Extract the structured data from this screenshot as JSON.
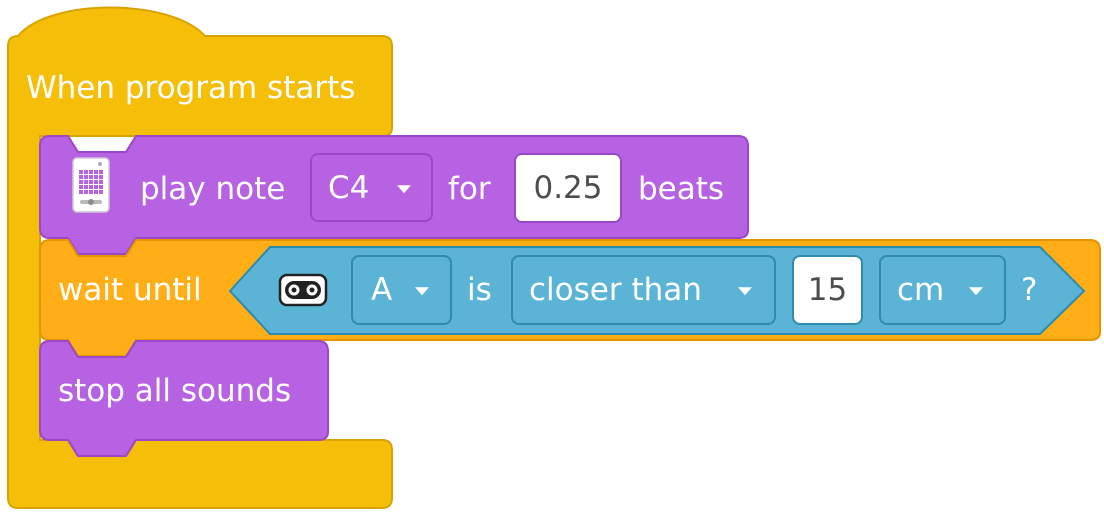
{
  "hat_block": {
    "label": "When program starts"
  },
  "play_note_block": {
    "icon": "hub-speaker-icon",
    "label": "play note",
    "note": "C4",
    "for_label": "for",
    "beats_value": "0.25",
    "beats_label": "beats"
  },
  "wait_until_block": {
    "label": "wait until",
    "condition": {
      "icon": "distance-sensor-icon",
      "port": "A",
      "is_label": "is",
      "comparison": "closer than",
      "distance_value": "15",
      "unit": "cm",
      "question_mark": "?"
    }
  },
  "stop_sounds_block": {
    "label": "stop all sounds"
  },
  "colors": {
    "events_yellow": "#F5BE09",
    "events_border": "#D9A402",
    "sound_purple": "#B762E3",
    "sound_border": "#9A48C8",
    "control_orange": "#FFAE17",
    "control_border": "#E59500",
    "sensor_blue": "#5BB4D6",
    "sensor_border": "#2E8BB0"
  }
}
